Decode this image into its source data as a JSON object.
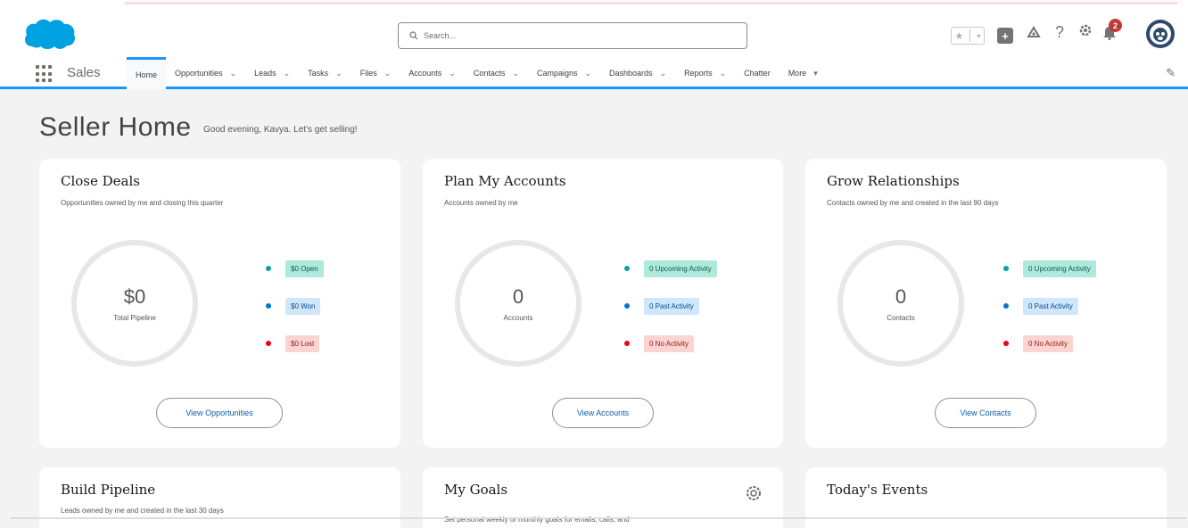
{
  "colors": {
    "brand": "#00a1e0",
    "accent": "#1b96ff",
    "teal_dot": "#06a59a",
    "blue_dot": "#0176d3",
    "red_dot": "#ea001e"
  },
  "header": {
    "search_placeholder": "Search...",
    "notification_count": "2",
    "icons": [
      "star-icon",
      "chevron-down-icon",
      "plus-icon",
      "trailhead-icon",
      "help-icon",
      "setup-gear-icon",
      "bell-icon",
      "avatar"
    ]
  },
  "nav": {
    "app_name": "Sales",
    "items": [
      {
        "label": "Home",
        "has_menu": false
      },
      {
        "label": "Opportunities",
        "has_menu": true
      },
      {
        "label": "Leads",
        "has_menu": true
      },
      {
        "label": "Tasks",
        "has_menu": true
      },
      {
        "label": "Files",
        "has_menu": true
      },
      {
        "label": "Accounts",
        "has_menu": true
      },
      {
        "label": "Contacts",
        "has_menu": true
      },
      {
        "label": "Campaigns",
        "has_menu": true
      },
      {
        "label": "Dashboards",
        "has_menu": true
      },
      {
        "label": "Reports",
        "has_menu": true
      },
      {
        "label": "Chatter",
        "has_menu": false
      },
      {
        "label": "More",
        "has_menu": true
      }
    ]
  },
  "page": {
    "title": "Seller Home",
    "greeting": "Good evening, Kavya. Let's get selling!"
  },
  "cards": {
    "close_deals": {
      "title": "Close Deals",
      "subtitle": "Opportunities owned by me and closing this quarter",
      "ring_value": "$0",
      "ring_label": "Total Pipeline",
      "legend": [
        "$0 Open",
        "$0 Won",
        "$0 Lost"
      ],
      "button": "View Opportunities"
    },
    "plan_accounts": {
      "title": "Plan My Accounts",
      "subtitle": "Accounts owned by me",
      "ring_value": "0",
      "ring_label": "Accounts",
      "legend": [
        "0 Upcoming Activity",
        "0 Past Activity",
        "0 No Activity"
      ],
      "button": "View Accounts"
    },
    "grow_relationships": {
      "title": "Grow Relationships",
      "subtitle": "Contacts owned by me and created in the last 90 days",
      "ring_value": "0",
      "ring_label": "Contacts",
      "legend": [
        "0 Upcoming Activity",
        "0 Past Activity",
        "0 No Activity"
      ],
      "button": "View Contacts"
    },
    "build_pipeline": {
      "title": "Build Pipeline",
      "subtitle": "Leads owned by me and created in the last 30 days"
    },
    "my_goals": {
      "title": "My Goals",
      "text": "Set personal weekly or monthly goals for emails, calls, and"
    },
    "todays_events": {
      "title": "Today's Events"
    }
  }
}
